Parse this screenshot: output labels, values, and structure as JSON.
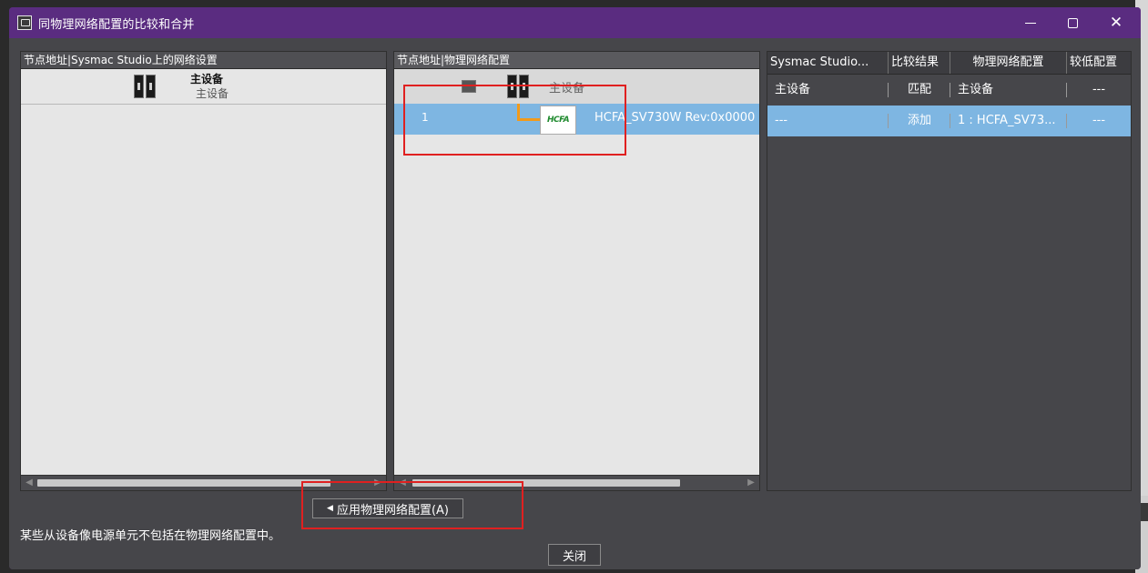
{
  "window": {
    "title": "同物理网络配置的比较和合并"
  },
  "left_panel": {
    "header": "节点地址|Sysmac Studio上的网络设置",
    "device": {
      "label": "主设备",
      "sublabel": "主设备"
    }
  },
  "middle_panel": {
    "header": "节点地址|物理网络配置",
    "root_device": {
      "label": "主设备"
    },
    "child_row": {
      "node": "1",
      "logo": "HCFA",
      "text": "HCFA_SV730W Rev:0x0000"
    }
  },
  "compare_table": {
    "columns": [
      "Sysmac Studio...",
      "比较结果",
      "物理网络配置",
      "较低配置"
    ],
    "rows": [
      {
        "sysmac": "主设备",
        "result": "匹配",
        "physical": "主设备",
        "lower": "---",
        "selected": false
      },
      {
        "sysmac": "---",
        "result": "添加",
        "physical": "1 : HCFA_SV73...",
        "lower": "---",
        "selected": true
      }
    ]
  },
  "apply_button": {
    "label": "应用物理网络配置(A)"
  },
  "status_message": "某些从设备像电源单元不包括在物理网络配置中。",
  "close_button": {
    "label": "关闭"
  },
  "colors": {
    "titlebar": "#5a2c80",
    "body": "#46464a",
    "selection": "#7eb6e2",
    "tree_line": "#f29a1a",
    "annotation": "#e02020"
  }
}
